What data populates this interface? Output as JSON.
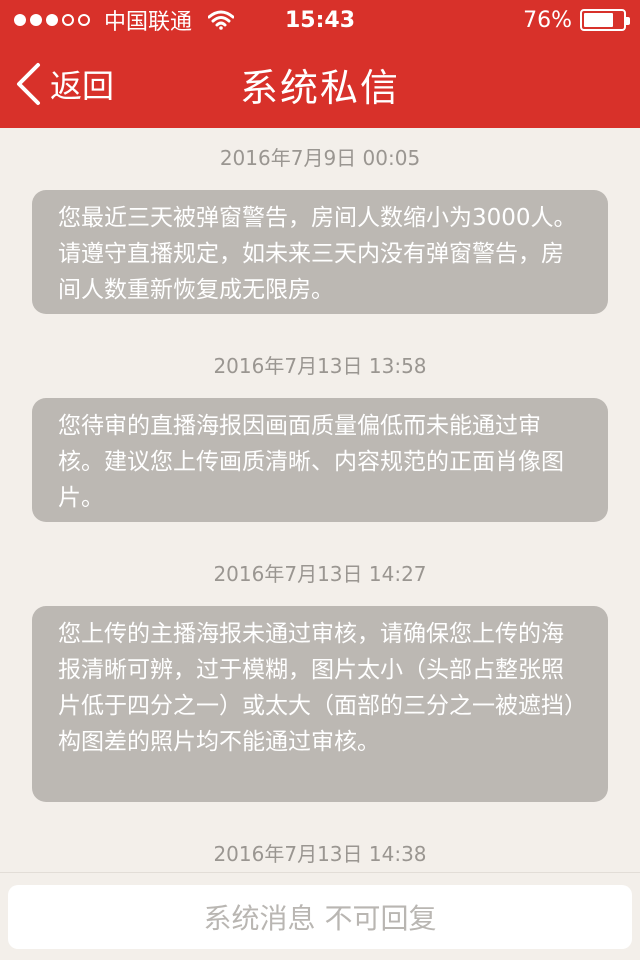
{
  "status_bar": {
    "carrier": "中国联通",
    "time": "15:43",
    "battery": "76%",
    "battery_level": 0.76,
    "signal_bars": 3,
    "signal_total": 5
  },
  "nav": {
    "back_label": "返回",
    "title": "系统私信"
  },
  "messages": [
    {
      "timestamp": "2016年7月9日 00:05",
      "text": "您最近三天被弹窗警告，房间人数缩小为3000人。请遵守直播规定，如未来三天内没有弹窗警告，房间人数重新恢复成无限房。"
    },
    {
      "timestamp": "2016年7月13日 13:58",
      "text": "您待审的直播海报因画面质量偏低而未能通过审核。建议您上传画质清晰、内容规范的正面肖像图片。"
    },
    {
      "timestamp": "2016年7月13日 14:27",
      "text": "您上传的主播海报未通过审核，请确保您上传的海报清晰可辨，过于模糊，图片太小（头部占整张照片低于四分之一）或太大（面部的三分之一被遮挡）构图差的照片均不能通过审核。"
    },
    {
      "timestamp": "2016年7月13日 14:38",
      "text": ""
    }
  ],
  "reply_bar": {
    "placeholder": "系统消息 不可回复"
  },
  "colors": {
    "nav_red": "#d8312a",
    "bubble_gray": "#bcb8b3",
    "background": "#f3efea"
  }
}
